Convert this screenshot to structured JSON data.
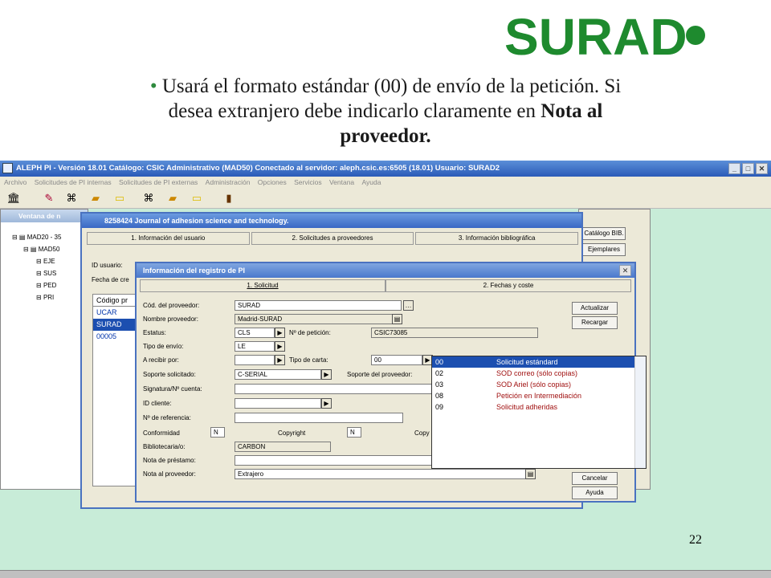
{
  "slide": {
    "bullet": "•",
    "line1": "Usará el formato estándar (00) de envío de la petición. Si",
    "line2": "desea extranjero debe indicarlo claramente en",
    "bold": "Nota al",
    "bold2": "proveedor.",
    "logo": "SURAD",
    "page_number": "22"
  },
  "app": {
    "title": "ALEPH PI - Versión 18.01  Catálogo: CSIC Administrativo (MAD50)  Conectado al servidor: aleph.csic.es:6505 (18.01)  Usuario: SURAD2",
    "menu": [
      "Archivo",
      "Solicitudes de PI internas",
      "Solicitudes de PI externas",
      "Administración",
      "Opciones",
      "Servicios",
      "Ventana",
      "Ayuda"
    ],
    "toolbar_icons": [
      "library-icon",
      "pen-icon",
      "binoculars-icon",
      "folder-open-icon",
      "folder-icon",
      "binoculars-icon",
      "folder-open-icon",
      "folder-icon",
      "exit-door-icon"
    ]
  },
  "bg_window": {
    "title": "Ventana de n",
    "tree": [
      "MAD20 - 35",
      "MAD50",
      "EJE",
      "SUS",
      "PED",
      "PRI"
    ]
  },
  "right_window": {
    "buttons": [
      "Catálogo BIB.",
      "Ejemplares"
    ]
  },
  "main_window": {
    "title": "8258424 Journal of adhesion science and technology.",
    "tabs": [
      "1. Información del usuario",
      "2. Solicitudes a proveedores",
      "3. Información bibliográfica"
    ],
    "id_label": "ID usuario:",
    "date_label": "Fecha de cre",
    "code_header": "Código pr",
    "codes": [
      "UCAR",
      "SURAD",
      "00005"
    ]
  },
  "dialog": {
    "title": "Información del registro de PI",
    "tabs": [
      "1. Solicitud",
      "2. Fechas y coste"
    ],
    "fields": {
      "cod_proveedor_label": "Cód. del proveedor:",
      "cod_proveedor": "SURAD",
      "nombre_label": "Nombre proveedor:",
      "nombre": "Madrid-SURAD",
      "estatus_label": "Estatus:",
      "estatus": "CLS",
      "peticion_label": "Nº de petición:",
      "peticion": "CSIC73085",
      "tipo_envio_label": "Tipo de envío:",
      "tipo_envio": "LE",
      "recibir_label": "A recibir por:",
      "recibir": "",
      "tipo_carta_label": "Tipo de carta:",
      "tipo_carta": "00",
      "soporte_label": "Soporte solicitado:",
      "soporte": "C-SERIAL",
      "soporte_prov_label": "Soporte del proveedor:",
      "signatura_label": "Signatura/Nº cuenta:",
      "id_cliente_label": "ID cliente:",
      "referencia_label": "Nº de referencia:",
      "conformidad_label": "Conformidad",
      "conformidad": "N",
      "copyright_label": "Copyright",
      "copyright": "N",
      "copy_label": "Copy",
      "bibliotecaria_label": "Bibliotecaria/o:",
      "bibliotecaria": "CARBON",
      "nota_prestamo_label": "Nota de préstamo:",
      "nota_proveedor_label": "Nota al proveedor:",
      "nota_proveedor": "Extrajero"
    },
    "buttons": [
      "Actualizar",
      "Recargar",
      "Cancelar",
      "Ayuda"
    ],
    "dropdown": [
      {
        "code": "00",
        "text": "Solicitud estándard",
        "selected": true
      },
      {
        "code": "02",
        "text": "SOD correo (sólo copias)",
        "selected": false
      },
      {
        "code": "03",
        "text": "SOD Ariel (sólo copias)",
        "selected": false
      },
      {
        "code": "08",
        "text": "Petición en Intermediación",
        "selected": false
      },
      {
        "code": "09",
        "text": "Solicitud adheridas",
        "selected": false
      }
    ]
  }
}
